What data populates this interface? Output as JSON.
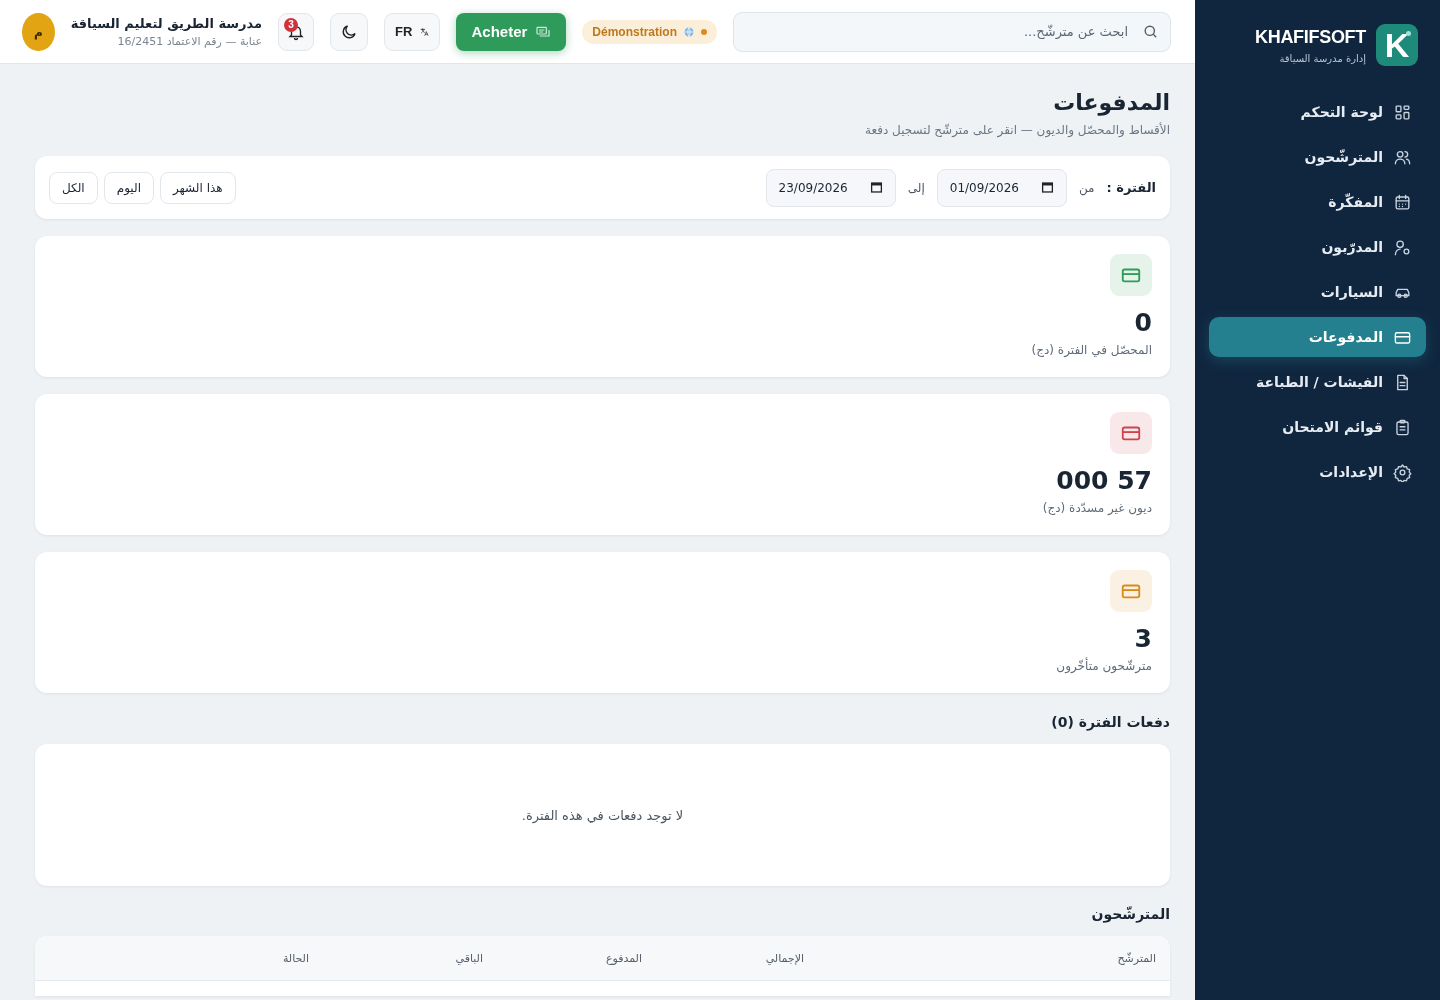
{
  "sidebar": {
    "logo": "K",
    "brand": "KHAFIFSOFT",
    "subtitle": "إدارة مدرسة السياقة",
    "items": [
      {
        "label": "لوحة التحكم",
        "selected": false
      },
      {
        "label": "المترشّحون",
        "selected": false
      },
      {
        "label": "المفكّرة",
        "selected": false
      },
      {
        "label": "المدرّبون",
        "selected": false
      },
      {
        "label": "السيارات",
        "selected": false
      },
      {
        "label": "المدفوعات",
        "selected": true
      },
      {
        "label": "الفيشات / الطباعة",
        "selected": false
      },
      {
        "label": "قوائم الامتحان",
        "selected": false
      },
      {
        "label": "الإعدادات",
        "selected": false
      }
    ]
  },
  "topbar": {
    "search": {
      "placeholder": "ابحث عن مترشّح..."
    },
    "demo_badge": "Démonstration",
    "buy_button": "Acheter",
    "language": "FR",
    "notifications": "3",
    "school_name": "مدرسة الطريق لتعليم السياقة",
    "school_info": "عنابة — رقم الاعتماد 16/2451",
    "avatar": "م"
  },
  "page": {
    "title": "المدفوعات",
    "subtitle": "الأقساط والمحصّل والديون — انقر على مترشّح لتسجيل دفعة"
  },
  "filter": {
    "label": "الفترة :",
    "from_label": "من",
    "from_value": "01/09/2026",
    "to_label": "إلى",
    "to_value": "23/09/2026",
    "presets": [
      {
        "label": "هذا الشهر",
        "selected": false
      },
      {
        "label": "اليوم",
        "selected": false
      },
      {
        "label": "الكل",
        "selected": false
      }
    ]
  },
  "stats": [
    {
      "value": "0",
      "label": "المحصّل في الفترة (دج)",
      "color": "#2e9b5b"
    },
    {
      "value": "57 000",
      "label": "ديون غير مسدّدة (دج)",
      "color": "#d0434e"
    },
    {
      "value": "3",
      "label": "مترشّحون متأخّرون",
      "color": "#d98a1c"
    }
  ],
  "payments": {
    "title": "دفعات الفترة (0)",
    "empty": "لا توجد دفعات في هذه الفترة."
  },
  "candidates": {
    "title": "المترشّحون",
    "columns": [
      "المترشّح",
      "الإجمالي",
      "المدفوع",
      "الباقي",
      "الحالة"
    ]
  }
}
